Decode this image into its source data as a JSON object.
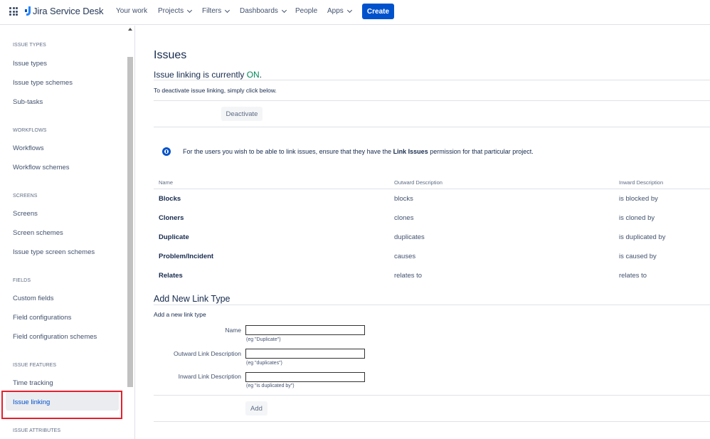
{
  "topnav": {
    "product_name": "Jira Service Desk",
    "items": [
      {
        "label": "Your work",
        "has_dropdown": false
      },
      {
        "label": "Projects",
        "has_dropdown": true
      },
      {
        "label": "Filters",
        "has_dropdown": true
      },
      {
        "label": "Dashboards",
        "has_dropdown": true
      },
      {
        "label": "People",
        "has_dropdown": false
      },
      {
        "label": "Apps",
        "has_dropdown": true
      }
    ],
    "create_label": "Create",
    "icons": [
      "app-switcher-icon",
      "jira-logo-icon",
      "chevron-down-icon"
    ]
  },
  "sidebar": {
    "sections": [
      {
        "title": "ISSUE TYPES",
        "items": [
          "Issue types",
          "Issue type schemes",
          "Sub-tasks"
        ]
      },
      {
        "title": "WORKFLOWS",
        "items": [
          "Workflows",
          "Workflow schemes"
        ]
      },
      {
        "title": "SCREENS",
        "items": [
          "Screens",
          "Screen schemes",
          "Issue type screen schemes"
        ]
      },
      {
        "title": "FIELDS",
        "items": [
          "Custom fields",
          "Field configurations",
          "Field configuration schemes"
        ]
      },
      {
        "title": "ISSUE FEATURES",
        "items": [
          "Time tracking",
          "Issue linking"
        ]
      },
      {
        "title": "ISSUE ATTRIBUTES",
        "items": []
      }
    ],
    "active_item": "Issue linking",
    "highlight_color": "#e5202d"
  },
  "main": {
    "title": "Issues",
    "status_prefix": "Issue linking is currently ",
    "status_value": "ON",
    "status_suffix": ".",
    "deactivate_hint": "To deactivate issue linking, simply click below.",
    "deactivate_label": "Deactivate",
    "info": {
      "before": "For the users you wish to be able to link issues, ensure that they have the ",
      "bold": "Link Issues",
      "after": " permission for that particular project.",
      "icon": "info-icon"
    },
    "table": {
      "headers": [
        "Name",
        "Outward Description",
        "Inward Description"
      ],
      "rows": [
        {
          "name": "Blocks",
          "outward": "blocks",
          "inward": "is blocked by"
        },
        {
          "name": "Cloners",
          "outward": "clones",
          "inward": "is cloned by"
        },
        {
          "name": "Duplicate",
          "outward": "duplicates",
          "inward": "is duplicated by"
        },
        {
          "name": "Problem/Incident",
          "outward": "causes",
          "inward": "is caused by"
        },
        {
          "name": "Relates",
          "outward": "relates to",
          "inward": "relates to"
        }
      ]
    },
    "add_form": {
      "title": "Add New Link Type",
      "subtitle": "Add a new link type",
      "fields": [
        {
          "label": "Name",
          "value": "",
          "hint": "(eg \"Duplicate\")"
        },
        {
          "label": "Outward Link Description",
          "value": "",
          "hint": "(eg \"duplicates\")"
        },
        {
          "label": "Inward Link Description",
          "value": "",
          "hint": "(eg \"is duplicated by\")"
        }
      ],
      "add_label": "Add"
    },
    "colors": {
      "accent": "#0052cc",
      "on_status": "#00875a"
    }
  }
}
